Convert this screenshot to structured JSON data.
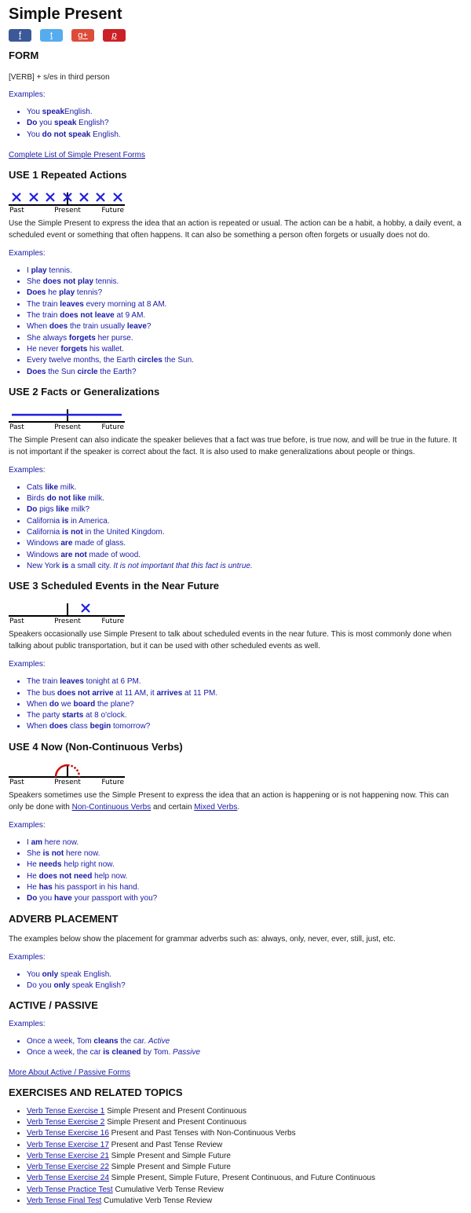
{
  "title": "Simple Present",
  "share": [
    {
      "name": "facebook-share-button",
      "glyph": "f",
      "color": "#3b5998"
    },
    {
      "name": "twitter-share-button",
      "glyph": "t",
      "color": "#55acee"
    },
    {
      "name": "google-plus-share-button",
      "glyph": "g+",
      "color": "#dd4b39"
    },
    {
      "name": "pinterest-share-button",
      "glyph": "p",
      "color": "#cb2027"
    }
  ],
  "timeline_labels": {
    "past": "Past",
    "present": "Present",
    "future": "Future"
  },
  "form": {
    "heading": "FORM",
    "formula": "[VERB] + s/es in third person",
    "examples_label": "Examples:",
    "examples": [
      [
        [
          "",
          "You "
        ],
        [
          "b",
          "speak"
        ],
        [
          "",
          "English."
        ]
      ],
      [
        [
          "b",
          "Do"
        ],
        [
          "",
          " you "
        ],
        [
          "b",
          "speak"
        ],
        [
          "",
          " English?"
        ]
      ],
      [
        [
          "",
          "You "
        ],
        [
          "b",
          "do not speak"
        ],
        [
          "",
          " English."
        ]
      ]
    ],
    "link": "Complete List of Simple Present Forms"
  },
  "use1": {
    "heading": "USE 1 Repeated Actions",
    "text": "Use the Simple Present to express the idea that an action is repeated or usual. The action can be a habit, a hobby, a daily event, a scheduled event or something that often happens. It can also be something a person often forgets or usually does not do.",
    "examples_label": "Examples:",
    "examples": [
      [
        [
          "",
          "I "
        ],
        [
          "b",
          "play"
        ],
        [
          "",
          " tennis."
        ]
      ],
      [
        [
          "",
          "She "
        ],
        [
          "b",
          "does not play"
        ],
        [
          "",
          " tennis."
        ]
      ],
      [
        [
          "b",
          "Does"
        ],
        [
          "",
          " he "
        ],
        [
          "b",
          "play"
        ],
        [
          "",
          " tennis?"
        ]
      ],
      [
        [
          "",
          "The train "
        ],
        [
          "b",
          "leaves"
        ],
        [
          "",
          " every morning at 8 AM."
        ]
      ],
      [
        [
          "",
          "The train "
        ],
        [
          "b",
          "does not leave"
        ],
        [
          "",
          " at 9 AM."
        ]
      ],
      [
        [
          "",
          "When "
        ],
        [
          "b",
          "does"
        ],
        [
          "",
          " the train usually "
        ],
        [
          "b",
          "leave"
        ],
        [
          "",
          "?"
        ]
      ],
      [
        [
          "",
          "She always "
        ],
        [
          "b",
          "forgets"
        ],
        [
          "",
          " her purse."
        ]
      ],
      [
        [
          "",
          "He never "
        ],
        [
          "b",
          "forgets"
        ],
        [
          "",
          " his wallet."
        ]
      ],
      [
        [
          "",
          "Every twelve months, the Earth "
        ],
        [
          "b",
          "circles"
        ],
        [
          "",
          " the Sun."
        ]
      ],
      [
        [
          "b",
          "Does"
        ],
        [
          "",
          " the Sun "
        ],
        [
          "b",
          "circle"
        ],
        [
          "",
          " the Earth?"
        ]
      ]
    ]
  },
  "use2": {
    "heading": "USE 2 Facts or Generalizations",
    "text": "The Simple Present can also indicate the speaker believes that a fact was true before, is true now, and will be true in the future. It is not important if the speaker is correct about the fact. It is also used to make generalizations about people or things.",
    "examples_label": "Examples:",
    "examples": [
      [
        [
          "",
          "Cats "
        ],
        [
          "b",
          "like"
        ],
        [
          "",
          " milk."
        ]
      ],
      [
        [
          "",
          "Birds "
        ],
        [
          "b",
          "do not like"
        ],
        [
          "",
          " milk."
        ]
      ],
      [
        [
          "b",
          "Do"
        ],
        [
          "",
          " pigs "
        ],
        [
          "b",
          "like"
        ],
        [
          "",
          " milk?"
        ]
      ],
      [
        [
          "",
          "California "
        ],
        [
          "b",
          "is"
        ],
        [
          "",
          " in America."
        ]
      ],
      [
        [
          "",
          "California "
        ],
        [
          "b",
          "is not"
        ],
        [
          "",
          " in the United Kingdom."
        ]
      ],
      [
        [
          "",
          "Windows "
        ],
        [
          "b",
          "are"
        ],
        [
          "",
          " made of glass."
        ]
      ],
      [
        [
          "",
          "Windows "
        ],
        [
          "b",
          "are not"
        ],
        [
          "",
          " made of wood."
        ]
      ],
      [
        [
          "",
          "New York "
        ],
        [
          "b",
          "is"
        ],
        [
          "",
          " a small city. "
        ],
        [
          "i",
          "It is not important that this fact is untrue."
        ]
      ]
    ]
  },
  "use3": {
    "heading": "USE 3 Scheduled Events in the Near Future",
    "text": "Speakers occasionally use Simple Present to talk about scheduled events in the near future. This is most commonly done when talking about public transportation, but it can be used with other scheduled events as well.",
    "examples_label": "Examples:",
    "examples": [
      [
        [
          "",
          "The train "
        ],
        [
          "b",
          "leaves"
        ],
        [
          "",
          " tonight at 6 PM."
        ]
      ],
      [
        [
          "",
          "The bus "
        ],
        [
          "b",
          "does not arrive"
        ],
        [
          "",
          " at 11 AM, it "
        ],
        [
          "b",
          "arrives"
        ],
        [
          "",
          " at 11 PM."
        ]
      ],
      [
        [
          "",
          "When "
        ],
        [
          "b",
          "do"
        ],
        [
          "",
          " we "
        ],
        [
          "b",
          "board"
        ],
        [
          "",
          " the plane?"
        ]
      ],
      [
        [
          "",
          "The party "
        ],
        [
          "b",
          "starts"
        ],
        [
          "",
          " at 8 o'clock."
        ]
      ],
      [
        [
          "",
          "When "
        ],
        [
          "b",
          "does"
        ],
        [
          "",
          " class "
        ],
        [
          "b",
          "begin"
        ],
        [
          "",
          " tomorrow?"
        ]
      ]
    ]
  },
  "use4": {
    "heading": "USE 4 Now (Non-Continuous Verbs)",
    "text_before": "Speakers sometimes use the Simple Present to express the idea that an action is happening or is not happening now. This can only be done with ",
    "link1": "Non-Continuous Verbs",
    "text_middle": " and certain ",
    "link2": "Mixed Verbs",
    "text_after": ".",
    "examples_label": "Examples:",
    "examples": [
      [
        [
          "",
          "I "
        ],
        [
          "b",
          "am"
        ],
        [
          "",
          " here now."
        ]
      ],
      [
        [
          "",
          "She "
        ],
        [
          "b",
          "is not"
        ],
        [
          "",
          " here now."
        ]
      ],
      [
        [
          "",
          "He "
        ],
        [
          "b",
          "needs"
        ],
        [
          "",
          " help right now."
        ]
      ],
      [
        [
          "",
          "He "
        ],
        [
          "b",
          "does not need"
        ],
        [
          "",
          " help now."
        ]
      ],
      [
        [
          "",
          "He "
        ],
        [
          "b",
          "has"
        ],
        [
          "",
          " his passport in his hand."
        ]
      ],
      [
        [
          "b",
          "Do"
        ],
        [
          "",
          " you "
        ],
        [
          "b",
          "have"
        ],
        [
          "",
          " your passport with you?"
        ]
      ]
    ]
  },
  "adverb": {
    "heading": "ADVERB PLACEMENT",
    "text": "The examples below show the placement for grammar adverbs such as: always, only, never, ever, still, just, etc.",
    "examples_label": "Examples:",
    "examples": [
      [
        [
          "",
          "You "
        ],
        [
          "b",
          "only"
        ],
        [
          "",
          " speak English."
        ]
      ],
      [
        [
          "",
          "Do you "
        ],
        [
          "b",
          "only"
        ],
        [
          "",
          " speak English?"
        ]
      ]
    ]
  },
  "passive": {
    "heading": "ACTIVE / PASSIVE",
    "examples_label": "Examples:",
    "examples": [
      [
        [
          "",
          "Once a week, Tom "
        ],
        [
          "b",
          "cleans"
        ],
        [
          "",
          " the car. "
        ],
        [
          "i",
          "Active"
        ]
      ],
      [
        [
          "",
          "Once a week, the car "
        ],
        [
          "b",
          "is cleaned"
        ],
        [
          "",
          " by Tom. "
        ],
        [
          "i",
          "Passive"
        ]
      ]
    ],
    "link": "More About Active / Passive Forms"
  },
  "exercises": {
    "heading": "EXERCISES AND RELATED TOPICS",
    "items": [
      {
        "link": "Verb Tense Exercise 1",
        "text": " Simple Present and Present Continuous"
      },
      {
        "link": "Verb Tense Exercise 2",
        "text": " Simple Present and Present Continuous"
      },
      {
        "link": "Verb Tense Exercise 16",
        "text": " Present and Past Tenses with Non-Continuous Verbs"
      },
      {
        "link": "Verb Tense Exercise 17",
        "text": " Present and Past Tense Review"
      },
      {
        "link": "Verb Tense Exercise 21",
        "text": " Simple Present and Simple Future"
      },
      {
        "link": "Verb Tense Exercise 22",
        "text": " Simple Present and Simple Future"
      },
      {
        "link": "Verb Tense Exercise 24",
        "text": " Simple Present, Simple Future, Present Continuous, and Future Continuous"
      },
      {
        "link": "Verb Tense Practice Test",
        "text": " Cumulative Verb Tense Review"
      },
      {
        "link": "Verb Tense Final Test",
        "text": " Cumulative Verb Tense Review"
      }
    ]
  }
}
